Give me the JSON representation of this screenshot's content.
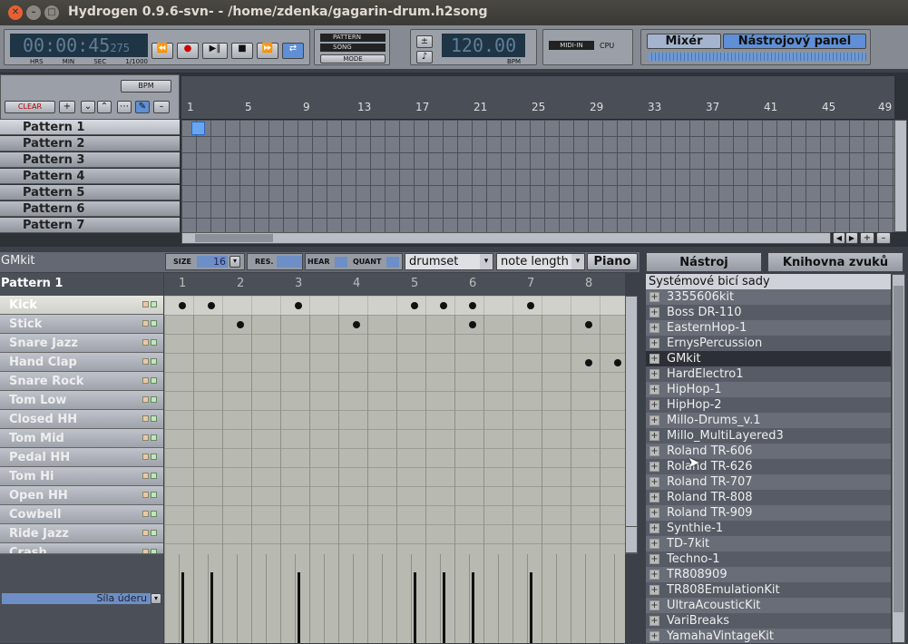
{
  "window": {
    "title": "Hydrogen 0.9.6-svn- - /home/zdenka/gagarin-drum.h2song"
  },
  "transport": {
    "time_display": "00:00:45",
    "time_ms": "275",
    "labels": [
      "HRS",
      "MIN",
      "SEC",
      "1/1000"
    ],
    "mode_pattern": "PATTERN",
    "mode_song": "SONG",
    "mode_btn": "MODE",
    "bpm_value": "120.00",
    "bpm_label": "BPM",
    "midi_in": "MIDI-IN",
    "cpu": "CPU",
    "mixer_btn": "Mixér",
    "instrument_panel_btn": "Nástrojový panel"
  },
  "song_editor": {
    "bpm_btn": "BPM",
    "clear_btn": "CLEAR",
    "ruler": [
      "1",
      "5",
      "9",
      "13",
      "17",
      "21",
      "25",
      "29",
      "33",
      "37",
      "41",
      "45",
      "49"
    ],
    "patterns": [
      "Pattern 1",
      "Pattern 2",
      "Pattern 3",
      "Pattern 4",
      "Pattern 5",
      "Pattern 6",
      "Pattern 7"
    ]
  },
  "pattern_editor": {
    "kit_name": "GMkit",
    "size_label": "SIZE",
    "size_value": "16",
    "res_label": "RES.",
    "hear_label": "HEAR",
    "quant_label": "QUANT",
    "pattern_select": "drumset",
    "note_length_select": "note length",
    "piano_btn": "Piano",
    "pattern_name": "Pattern 1",
    "beat_labels": [
      "1",
      "2",
      "3",
      "4",
      "5",
      "6",
      "7",
      "8"
    ],
    "instruments": [
      "Kick",
      "Stick",
      "Snare Jazz",
      "Hand Clap",
      "Snare Rock",
      "Tom Low",
      "Closed HH",
      "Tom Mid",
      "Pedal HH",
      "Tom Hi",
      "Open HH",
      "Cowbell",
      "Ride Jazz",
      "Crash"
    ],
    "velocity_label": "Síla úderu"
  },
  "right_panel": {
    "tab_instrument": "Nástroj",
    "tab_library": "Knihovna zvuků",
    "tree_header": "Systémové bicí sady",
    "kits": [
      "3355606kit",
      "Boss DR-110",
      "EasternHop-1",
      "ErnysPercussion",
      "GMkit",
      "HardElectro1",
      "HipHop-1",
      "HipHop-2",
      "Millo-Drums_v.1",
      "Millo_MultiLayered3",
      "Roland TR-606",
      "Roland TR-626",
      "Roland TR-707",
      "Roland TR-808",
      "Roland TR-909",
      "Synthie-1",
      "TD-7kit",
      "Techno-1",
      "TR808909",
      "TR808EmulationKit",
      "UltraAcousticKit",
      "VariBreaks",
      "YamahaVintageKit"
    ],
    "selected_kit": "GMkit"
  }
}
